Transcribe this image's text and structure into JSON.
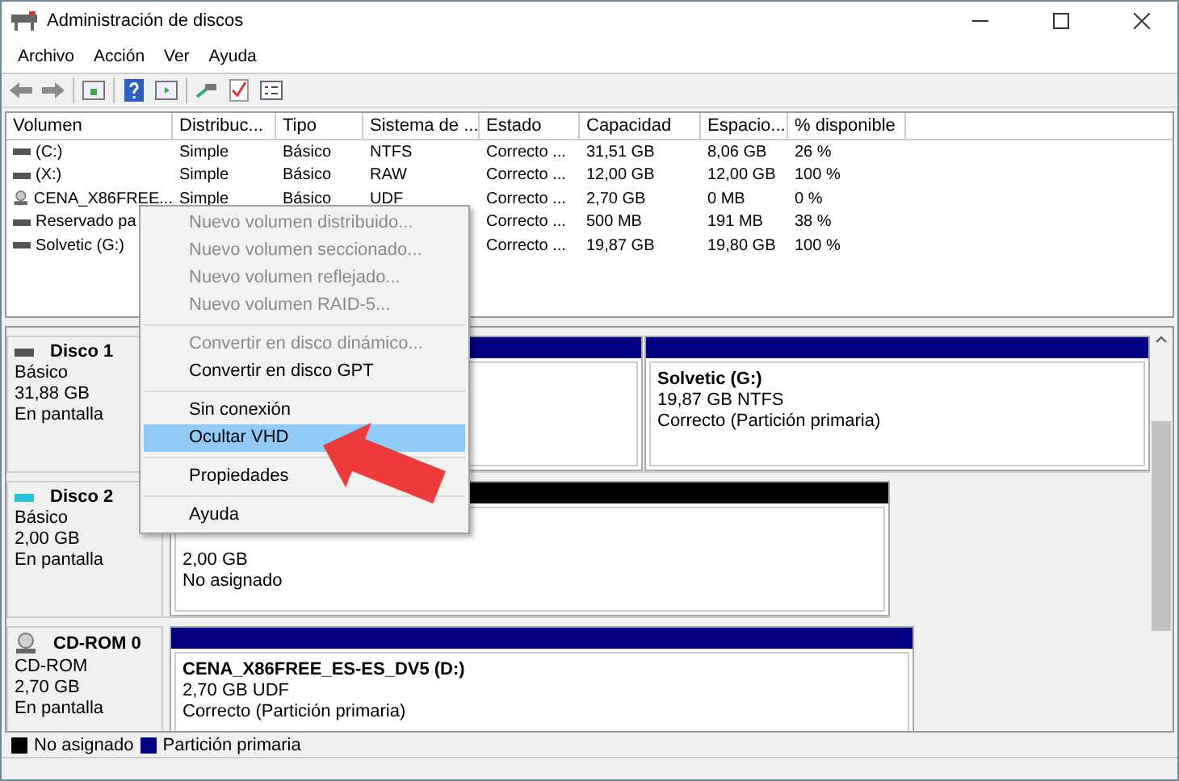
{
  "window": {
    "title": "Administración de discos"
  },
  "menu": [
    "Archivo",
    "Acción",
    "Ver",
    "Ayuda"
  ],
  "volumes": {
    "columns": [
      "Volumen",
      "Distribuc...",
      "Tipo",
      "Sistema de ...",
      "Estado",
      "Capacidad",
      "Espacio...",
      "% disponible"
    ],
    "rows": [
      {
        "kind": "disk",
        "cells": [
          "(C:)",
          "Simple",
          "Básico",
          "NTFS",
          "Correcto ...",
          "31,51 GB",
          "8,06 GB",
          "26 %"
        ]
      },
      {
        "kind": "disk",
        "cells": [
          "(X:)",
          "Simple",
          "Básico",
          "RAW",
          "Correcto ...",
          "12,00 GB",
          "12,00 GB",
          "100 %"
        ]
      },
      {
        "kind": "cdrom",
        "cells": [
          "CENA_X86FREE...",
          "Simple",
          "Básico",
          "UDF",
          "Correcto ...",
          "2,70 GB",
          "0 MB",
          "0 %"
        ]
      },
      {
        "kind": "disk",
        "cells": [
          "Reservado pa",
          null,
          null,
          null,
          "Correcto ...",
          "500 MB",
          "191 MB",
          "38 %"
        ]
      },
      {
        "kind": "disk",
        "cells": [
          "Solvetic (G:)",
          null,
          null,
          null,
          "Correcto ...",
          "19,87 GB",
          "19,80 GB",
          "100 %"
        ]
      }
    ]
  },
  "disks": [
    {
      "kind": "disk",
      "name": "Disco 1",
      "details": [
        "Básico",
        "31,88 GB",
        "En pantalla"
      ],
      "partitions": [
        {
          "kind": "primary"
        },
        {
          "kind": "primary",
          "lines": [
            "Solvetic  (G:)",
            "19,87 GB NTFS",
            "Correcto (Partición primaria)"
          ]
        }
      ]
    },
    {
      "kind": "vhd",
      "name": "Disco 2",
      "details": [
        "Básico",
        "2,00 GB",
        "En pantalla"
      ],
      "partitions": [
        {
          "kind": "unallocated",
          "lines": [
            "2,00 GB",
            "No asignado"
          ]
        }
      ]
    },
    {
      "kind": "cdrom",
      "name": "CD-ROM 0",
      "details": [
        "CD-ROM",
        "2,70 GB",
        "En pantalla"
      ],
      "partitions": [
        {
          "kind": "primary",
          "lines": [
            "CENA_X86FREE_ES-ES_DV5  (D:)",
            "2,70 GB UDF",
            "Correcto (Partición primaria)"
          ]
        }
      ]
    }
  ],
  "legend": [
    {
      "label": "No asignado",
      "color": "#000000"
    },
    {
      "label": "Partición primaria",
      "color": "#000080"
    }
  ],
  "context_menu": [
    [
      {
        "label": "Nuevo volumen distribuido...",
        "disabled": true,
        "selected": false
      },
      {
        "label": "Nuevo volumen seccionado...",
        "disabled": true,
        "selected": false
      },
      {
        "label": "Nuevo volumen reflejado...",
        "disabled": true,
        "selected": false
      },
      {
        "label": "Nuevo volumen RAID-5...",
        "disabled": true,
        "selected": false
      }
    ],
    [
      {
        "label": "Convertir en disco dinámico...",
        "disabled": true,
        "selected": false
      },
      {
        "label": "Convertir en disco GPT",
        "disabled": false,
        "selected": false
      }
    ],
    [
      {
        "label": "Sin conexión",
        "disabled": false,
        "selected": false
      },
      {
        "label": "Ocultar VHD",
        "disabled": false,
        "selected": true
      }
    ],
    [
      {
        "label": "Propiedades",
        "disabled": false,
        "selected": false
      }
    ],
    [
      {
        "label": "Ayuda",
        "disabled": false,
        "selected": false
      }
    ]
  ]
}
